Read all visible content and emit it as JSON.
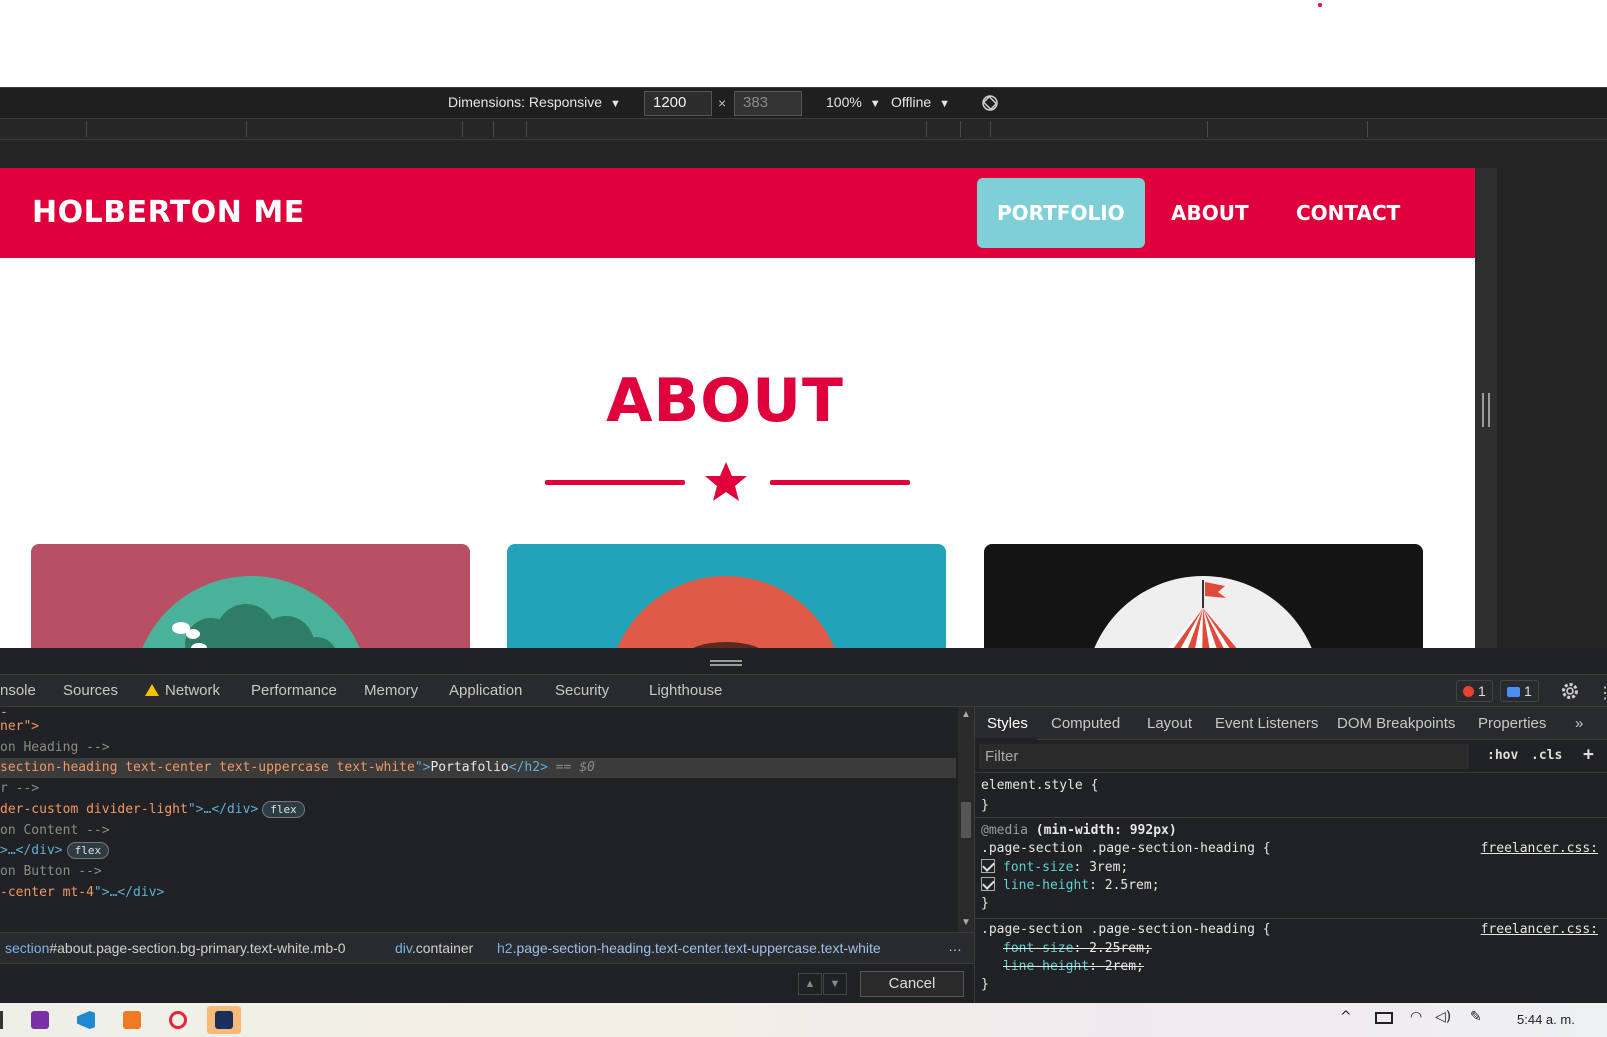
{
  "device_toolbar": {
    "dimensions_label": "Dimensions: Responsive",
    "width_value": "1200",
    "height_value": "383",
    "times": "×",
    "zoom": "100%",
    "throttle": "Offline",
    "dropdown_arrow": "▼"
  },
  "page": {
    "brand": "HOLBERTON ME",
    "nav": [
      {
        "label": "PORTFOLIO",
        "active": true
      },
      {
        "label": "ABOUT",
        "active": false
      },
      {
        "label": "CONTACT",
        "active": false
      }
    ],
    "section_title": "ABOUT",
    "colors": {
      "primary": "#e0003c",
      "active_nav": "#7fd0d6",
      "card1": "#b94f63",
      "card2": "#22a3b8",
      "card3": "#141414"
    }
  },
  "devtools": {
    "tabs": [
      "nsole",
      "Sources",
      "Network",
      "Performance",
      "Memory",
      "Application",
      "Security",
      "Lighthouse"
    ],
    "error_count": "1",
    "message_count": "1",
    "elements": [
      {
        "pre": "ner\">",
        "kind": "tagend"
      },
      {
        "pre": "on Heading -->",
        "kind": "comment"
      },
      {
        "pre": "section-heading text-center text-uppercase text-white",
        "post": "\">",
        "text": "Portafolio",
        "close": "</h2>",
        "marker": " == $0",
        "kind": "selected"
      },
      {
        "pre": "r -->",
        "kind": "comment"
      },
      {
        "pre": "der-custom divider-light",
        "post": "\">…</div>",
        "badge": "flex",
        "kind": "tagbadge"
      },
      {
        "pre": "on Content -->",
        "kind": "comment"
      },
      {
        "pre": ">…</div>",
        "badge": "flex",
        "kind": "tagbadge2"
      },
      {
        "pre": "on Button -->",
        "kind": "comment"
      },
      {
        "pre": "-center mt-4",
        "post": "\">…</div>",
        "kind": "tagattr"
      }
    ],
    "breadcrumbs": [
      {
        "tag": "section",
        "rest": "#about.page-section.bg-primary.text-white.mb-0"
      },
      {
        "tag": "div",
        "rest": ".container"
      },
      {
        "tag": "h2",
        "rest": ".page-section-heading.text-center.text-uppercase.text-white"
      }
    ],
    "crumb_more": "…",
    "cancel_label": "Cancel",
    "styles_tabs": [
      "Styles",
      "Computed",
      "Layout",
      "Event Listeners",
      "DOM Breakpoints",
      "Properties"
    ],
    "styles_more": "»",
    "filter_placeholder": "Filter",
    "hov": ":hov",
    "cls": ".cls",
    "plus": "+",
    "rules": {
      "element_style": "element.style {",
      "close_brace": "}",
      "media_keyword": "@media",
      "media_query": "(min-width: 992px)",
      "selector": ".page-section .page-section-heading {",
      "source": "freelancer.css:",
      "rule1_props": [
        {
          "name": "font-size",
          "value": "3rem;"
        },
        {
          "name": "line-height",
          "value": "2.5rem;"
        }
      ],
      "rule2_props": [
        {
          "name": "font-size",
          "value": "2.25rem;"
        },
        {
          "name": "line-height",
          "value": "2rem;"
        }
      ]
    }
  },
  "taskbar": {
    "clock": "5:44 a. m.",
    "apps": [
      "onenote-icon",
      "vscode-icon",
      "xampp-icon",
      "opera-icon",
      "app-icon"
    ]
  }
}
